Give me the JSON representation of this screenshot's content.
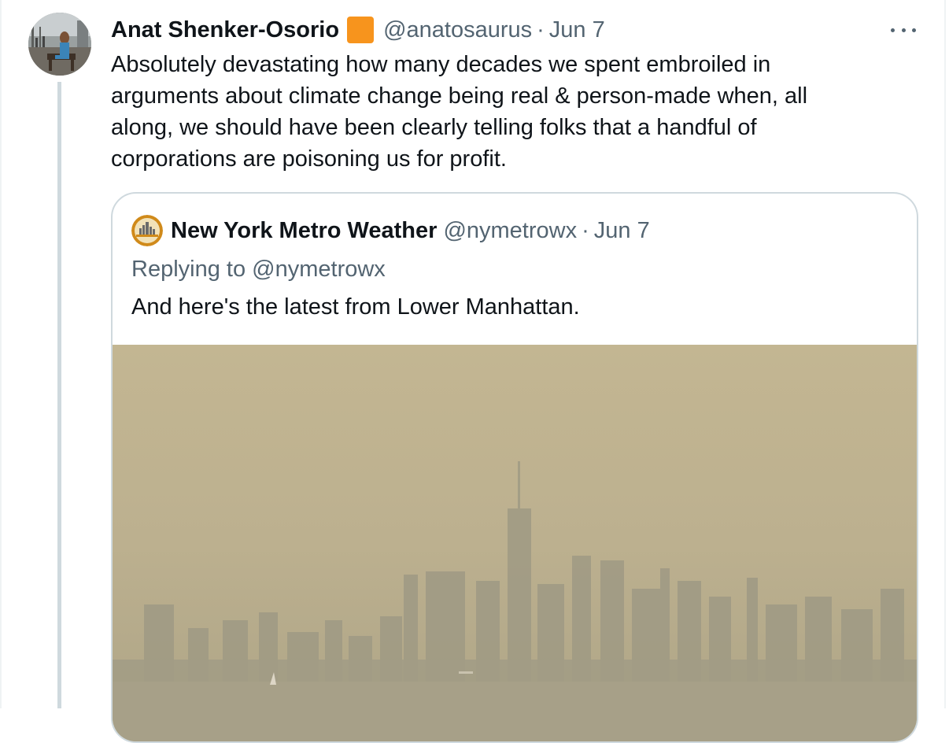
{
  "tweet": {
    "display_name": "Anat Shenker-Osorio",
    "verified_badge_color": "#f7941d",
    "handle": "@anatosaurus",
    "separator": "·",
    "date": "Jun 7",
    "more_icon": "more-horizontal-icon",
    "text": "Absolutely devastating how many decades we spent embroiled in\narguments about climate change being real & person-made when, all\nalong, we should have been clearly telling folks that a handful of\ncorporations are poisoning us for profit."
  },
  "quoted_tweet": {
    "display_name": "New York Metro Weather",
    "handle": "@nymetrowx",
    "separator": "·",
    "date": "Jun 7",
    "replying_prefix": "Replying to",
    "replying_to": "@nymetrowx",
    "text": "And here's the latest from Lower Manhattan.",
    "media_alt": "Smoky haze over Lower Manhattan skyline"
  },
  "colors": {
    "text_primary": "#0f1419",
    "text_secondary": "#536471",
    "border": "#cfd9de",
    "haze_top": "#c2b592",
    "haze_bottom": "#a69f83"
  }
}
